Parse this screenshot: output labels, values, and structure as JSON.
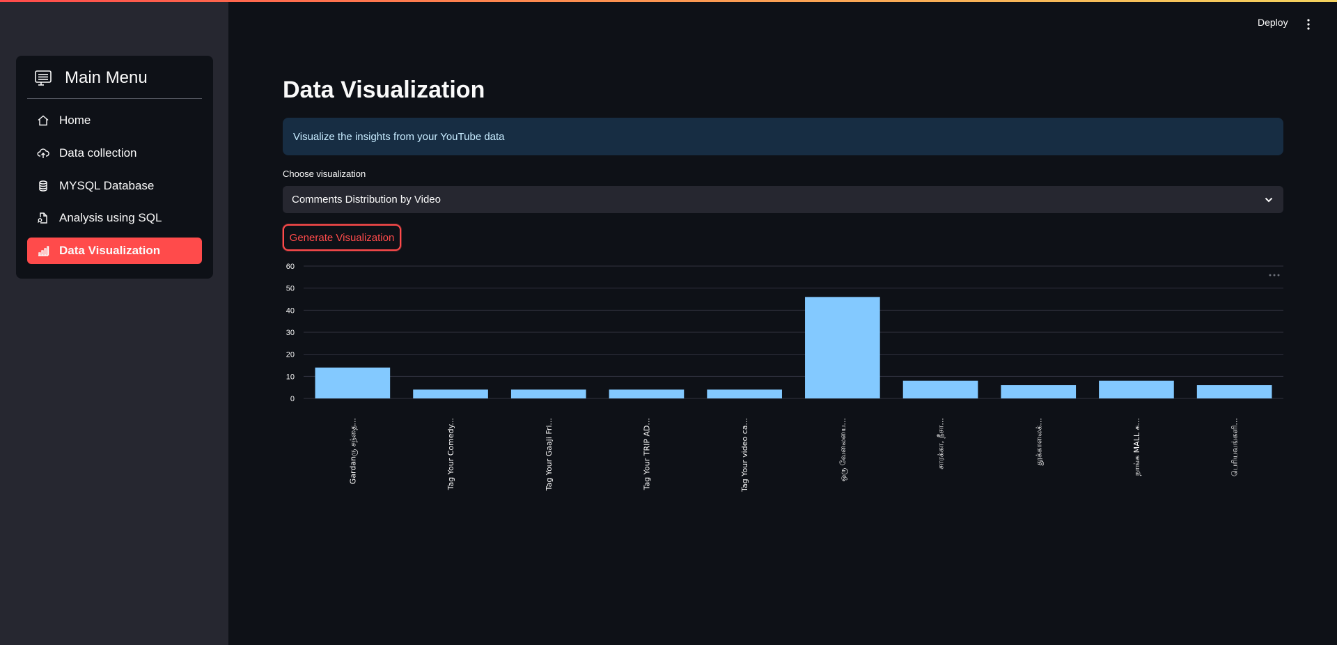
{
  "app": {
    "deploy_label": "Deploy",
    "menu_icon": "kebab-vertical-icon"
  },
  "sidebar": {
    "title": "Main Menu",
    "title_icon": "menu-list-icon",
    "items": [
      {
        "label": "Home",
        "icon": "house-icon",
        "active": false
      },
      {
        "label": "Data collection",
        "icon": "cloud-upload-icon",
        "active": false
      },
      {
        "label": "MYSQL Database",
        "icon": "database-icon",
        "active": false
      },
      {
        "label": "Analysis using SQL",
        "icon": "file-search-icon",
        "active": false
      },
      {
        "label": "Data Visualization",
        "icon": "bar-chart-icon",
        "active": true
      }
    ]
  },
  "main": {
    "title": "Data Visualization",
    "info_text": "Visualize the insights from your YouTube data",
    "select_label": "Choose visualization",
    "select_value": "Comments Distribution by Video",
    "button_label": "Generate Visualization"
  },
  "colors": {
    "accent": "#ff4b4b",
    "bar": "#83c9ff",
    "background": "#0e1117",
    "sidebar": "#262730",
    "info_bg": "#172d43"
  },
  "chart_data": {
    "type": "bar",
    "categories": [
      "Gardanரு சந்தை...",
      "Tag Your Comedy...",
      "Tag Your Gaaji Fri...",
      "Tag Your TRIP AD...",
      "Tag Your video ca...",
      "ஒரு வேலையை...",
      "சாரக்கா, நீசா...",
      "தூக்காலைக்...",
      "நாங்க MALL க...",
      "பெரியவங்களி..."
    ],
    "values": [
      14,
      4,
      4,
      4,
      4,
      46,
      8,
      6,
      8,
      6
    ],
    "ylim": [
      0,
      60
    ],
    "yticks": [
      0,
      10,
      20,
      30,
      40,
      50,
      60
    ],
    "grid": true,
    "xlabel": "",
    "ylabel": ""
  }
}
